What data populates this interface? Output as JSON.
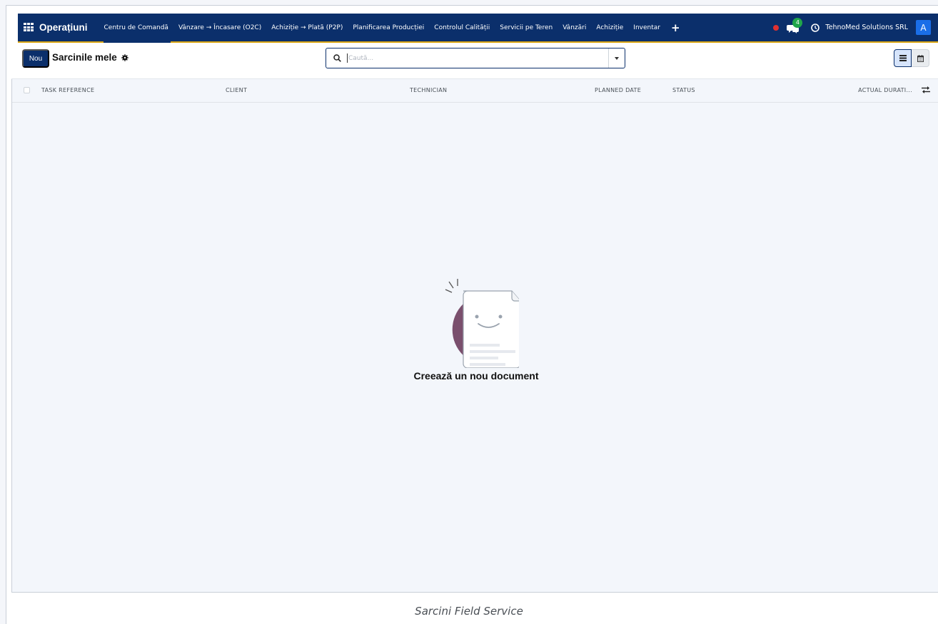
{
  "navbar": {
    "app_name": "Operațiuni",
    "menu": [
      "Centru de Comandă",
      "Vânzare → Încasare (O2C)",
      "Achiziție → Plată (P2P)",
      "Planificarea Producției",
      "Controlul Calității",
      "Servicii pe Teren",
      "Vânzări",
      "Achiziție",
      "Inventar"
    ],
    "plus_label": "+",
    "chat_badge": "4",
    "company": "TehnoMed Solutions SRL",
    "avatar_letter": "A",
    "colors": {
      "bar": "#0b2f6b",
      "accent": "#d9a513",
      "badge": "#21a64a",
      "dot": "#e03131",
      "avatar": "#1a6ee8"
    }
  },
  "controlbar": {
    "new_label": "Nou",
    "breadcrumb": "Sarcinile mele",
    "search": {
      "placeholder": "Caută..."
    }
  },
  "table": {
    "columns": [
      "TASK REFERENCE",
      "CLIENT",
      "TECHNICIAN",
      "PLANNED DATE",
      "STATUS",
      "ACTUAL DURATI..."
    ]
  },
  "empty_state": {
    "title": "Creează un nou document"
  },
  "caption": "Sarcini Field Service"
}
